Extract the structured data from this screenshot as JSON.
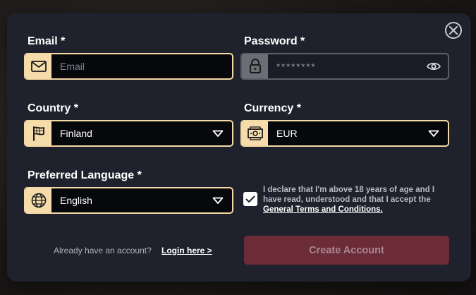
{
  "form": {
    "email": {
      "label": "Email *",
      "placeholder": "Email",
      "value": ""
    },
    "password": {
      "label": "Password *",
      "masked_value": "********"
    },
    "country": {
      "label": "Country *",
      "selected": "Finland"
    },
    "currency": {
      "label": "Currency *",
      "selected": "EUR"
    },
    "language": {
      "label": "Preferred Language *",
      "selected": "English"
    },
    "declaration": {
      "checked": true,
      "text": "I declare that I'm above 18 years of age and I have read, understood and that I accept the",
      "link_text": "General Terms and Conditions."
    }
  },
  "footer": {
    "already_text": "Already have an account?",
    "login_link": "Login here >",
    "create_button": "Create Account"
  },
  "icons": {
    "close": "close-icon",
    "email": "envelope-icon",
    "password": "lock-icon",
    "visibility": "eye-icon",
    "country": "flag-icon",
    "currency": "banknote-icon",
    "language": "globe-icon",
    "dropdown": "chevron-down-icon",
    "check": "checkmark-icon"
  },
  "colors": {
    "accent": "#f5dcaa",
    "modal_bg": "#1f222c",
    "field_bg": "#07080b",
    "create_button_bg": "#6b2c37"
  }
}
